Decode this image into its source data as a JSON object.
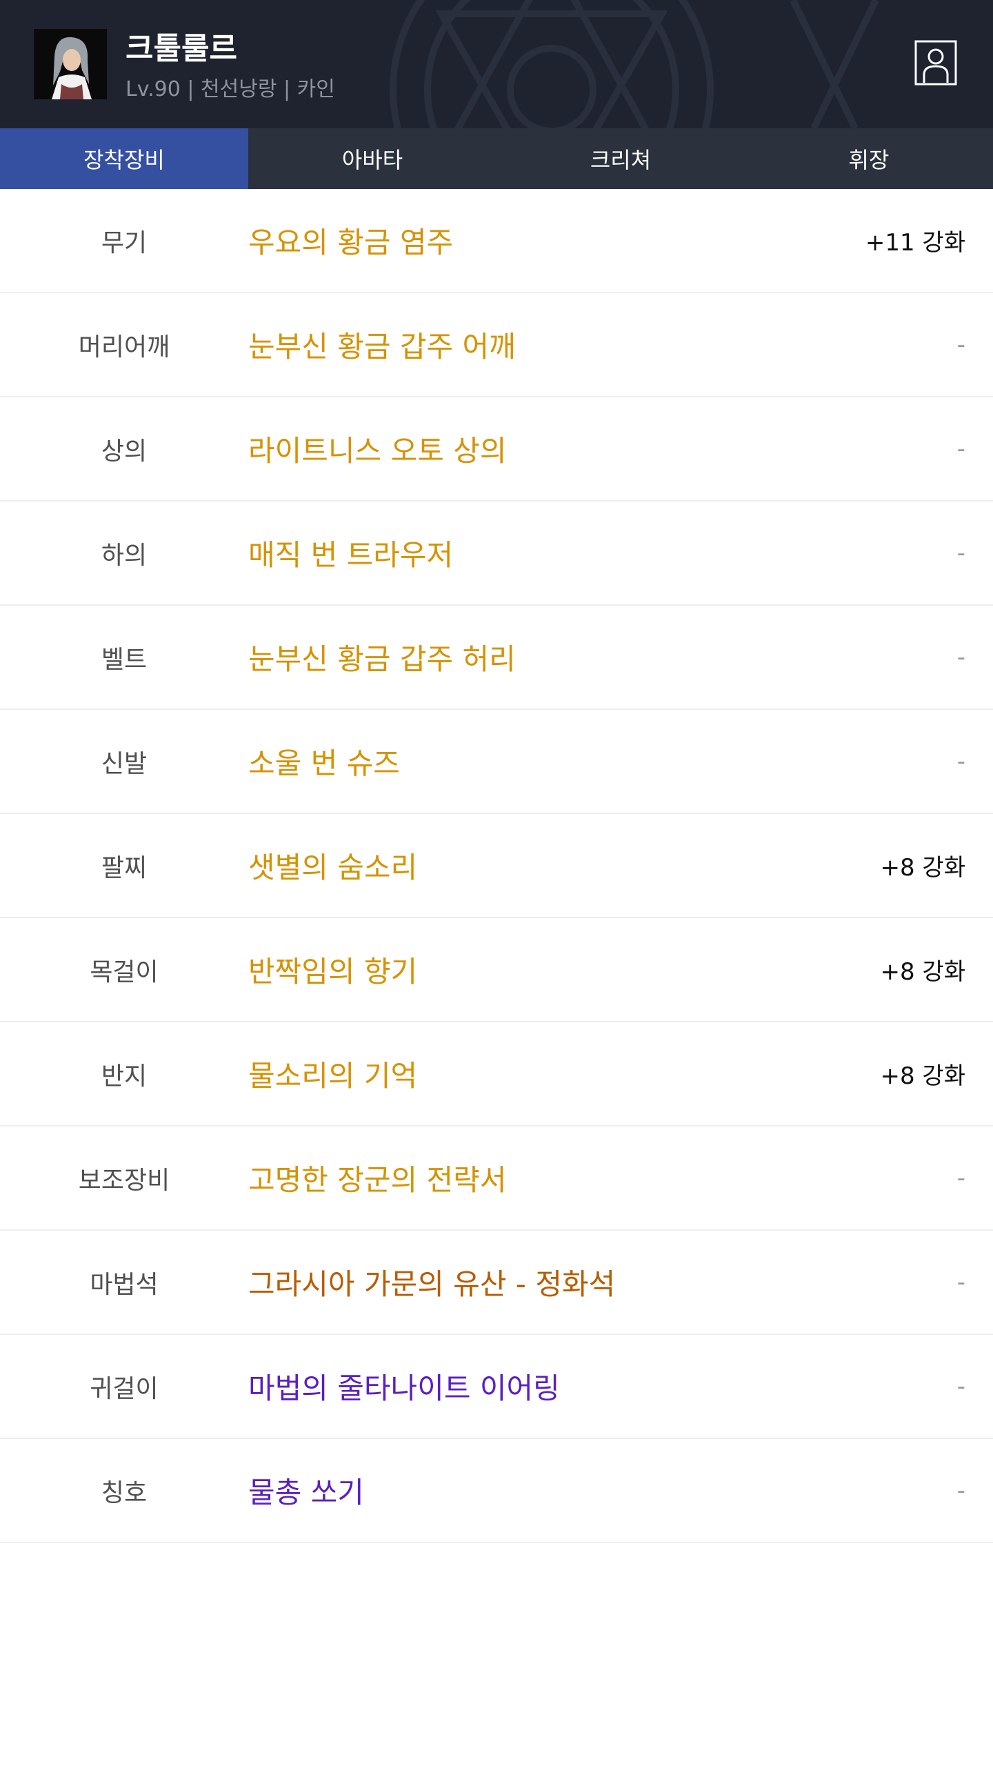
{
  "header": {
    "character_name": "크툴룰르",
    "subtitle": "Lv.90 | 천선낭랑 | 카인",
    "profile_icon": "person-icon"
  },
  "tabs": [
    {
      "label": "장착장비",
      "active": true
    },
    {
      "label": "아바타",
      "active": false
    },
    {
      "label": "크리쳐",
      "active": false
    },
    {
      "label": "휘장",
      "active": false
    }
  ],
  "colors": {
    "epic": "#d69200",
    "legendary": "#b85c00",
    "unique": "#5a1fc2",
    "active_tab": "#3550a0"
  },
  "equipment": [
    {
      "slot": "무기",
      "item": "우요의 황금 염주",
      "enhance": "+11 강화",
      "color": "#d69200"
    },
    {
      "slot": "머리어깨",
      "item": "눈부신 황금 갑주 어깨",
      "enhance": "-",
      "color": "#d69200"
    },
    {
      "slot": "상의",
      "item": "라이트니스 오토 상의",
      "enhance": "-",
      "color": "#d69200"
    },
    {
      "slot": "하의",
      "item": "매직 번 트라우저",
      "enhance": "-",
      "color": "#d69200"
    },
    {
      "slot": "벨트",
      "item": "눈부신 황금 갑주 허리",
      "enhance": "-",
      "color": "#d69200"
    },
    {
      "slot": "신발",
      "item": "소울 번 슈즈",
      "enhance": "-",
      "color": "#d69200"
    },
    {
      "slot": "팔찌",
      "item": "샛별의 숨소리",
      "enhance": "+8 강화",
      "color": "#d69200"
    },
    {
      "slot": "목걸이",
      "item": "반짝임의 향기",
      "enhance": "+8 강화",
      "color": "#d69200"
    },
    {
      "slot": "반지",
      "item": "물소리의 기억",
      "enhance": "+8 강화",
      "color": "#d69200"
    },
    {
      "slot": "보조장비",
      "item": "고명한 장군의 전략서",
      "enhance": "-",
      "color": "#d69200"
    },
    {
      "slot": "마법석",
      "item": "그라시아 가문의 유산 - 정화석",
      "enhance": "-",
      "color": "#b85c00"
    },
    {
      "slot": "귀걸이",
      "item": "마법의 줄타나이트 이어링",
      "enhance": "-",
      "color": "#5a1fc2"
    },
    {
      "slot": "칭호",
      "item": "물총 쏘기",
      "enhance": "-",
      "color": "#5a1fc2"
    }
  ]
}
